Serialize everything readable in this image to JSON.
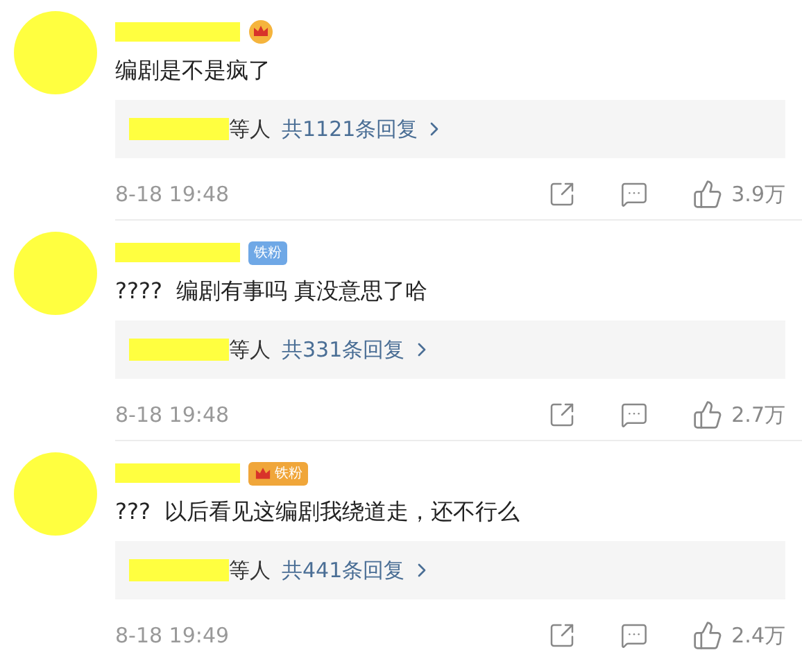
{
  "comments": [
    {
      "badges": [
        {
          "kind": "crown"
        }
      ],
      "text": "编剧是不是疯了",
      "replies": {
        "suffix": "等人",
        "link": "共1121条回复"
      },
      "time": "8-18 19:48",
      "likes": "3.9万"
    },
    {
      "badges": [
        {
          "kind": "fan",
          "label": "铁粉",
          "color": "#6fa8e6"
        }
      ],
      "text": "????  编剧有事吗 真没意思了哈",
      "replies": {
        "suffix": "等人",
        "link": "共331条回复"
      },
      "time": "8-18 19:48",
      "likes": "2.7万"
    },
    {
      "badges": [
        {
          "kind": "crown-fan",
          "label": "铁粉",
          "color": "#f0a63a"
        }
      ],
      "text": "???  以后看见这编剧我绕道走，还不行么",
      "replies": {
        "suffix": "等人",
        "link": "共441条回复"
      },
      "time": "8-18 19:49",
      "likes": "2.4万"
    }
  ]
}
